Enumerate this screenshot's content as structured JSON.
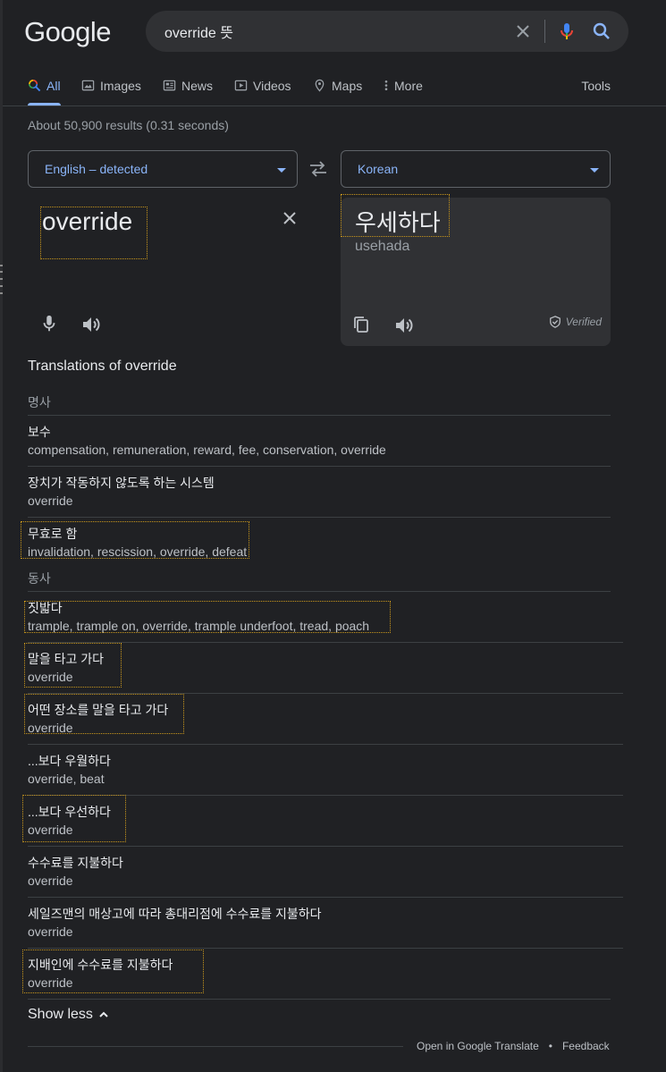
{
  "logo": "Google",
  "search": {
    "query": "override 뜻"
  },
  "tabs": [
    {
      "label": "All",
      "icon": "search-color-icon",
      "active": true
    },
    {
      "label": "Images",
      "icon": "image-icon"
    },
    {
      "label": "News",
      "icon": "news-icon"
    },
    {
      "label": "Videos",
      "icon": "play-icon"
    },
    {
      "label": "Maps",
      "icon": "map-pin-icon"
    },
    {
      "label": "More",
      "icon": "kebab-icon"
    }
  ],
  "tools_label": "Tools",
  "stats": "About 50,900 results (0.31 seconds)",
  "translator": {
    "source_lang": "English – detected",
    "target_lang": "Korean",
    "source_text": "override",
    "target_text": "우세하다",
    "romanization": "usehada",
    "verified_label": "Verified"
  },
  "translations": {
    "title": "Translations of override",
    "noun_label": "명사",
    "verb_label": "동사",
    "nouns": [
      {
        "word": "보수",
        "translations": "compensation, remuneration, reward, fee, conservation, override"
      },
      {
        "word": "장치가 작동하지 않도록 하는 시스템",
        "translations": "override"
      },
      {
        "word": "무효로 함",
        "translations": "invalidation, rescission, override, defeat"
      }
    ],
    "verbs": [
      {
        "word": "짓밟다",
        "translations": "trample, trample on, override, trample underfoot, tread, poach"
      },
      {
        "word": "말을 타고 가다",
        "translations": "override"
      },
      {
        "word": "어떤 장소를 말을 타고 가다",
        "translations": "override"
      },
      {
        "word": "...보다 우월하다",
        "translations": "override, beat"
      },
      {
        "word": "...보다 우선하다",
        "translations": "override"
      },
      {
        "word": "수수료를 지불하다",
        "translations": "override"
      },
      {
        "word": "세일즈맨의 매상고에 따라 총대리점에 수수료를 지불하다",
        "translations": "override"
      },
      {
        "word": "지배인에 수수료를 지불하다",
        "translations": "override"
      }
    ]
  },
  "show_less": "Show less",
  "footer": {
    "open_translate": "Open in Google Translate",
    "separator": "•",
    "feedback": "Feedback"
  },
  "colors": {
    "background": "#202124",
    "accent": "#8ab4f8",
    "highlight_border": "#c8961c"
  }
}
